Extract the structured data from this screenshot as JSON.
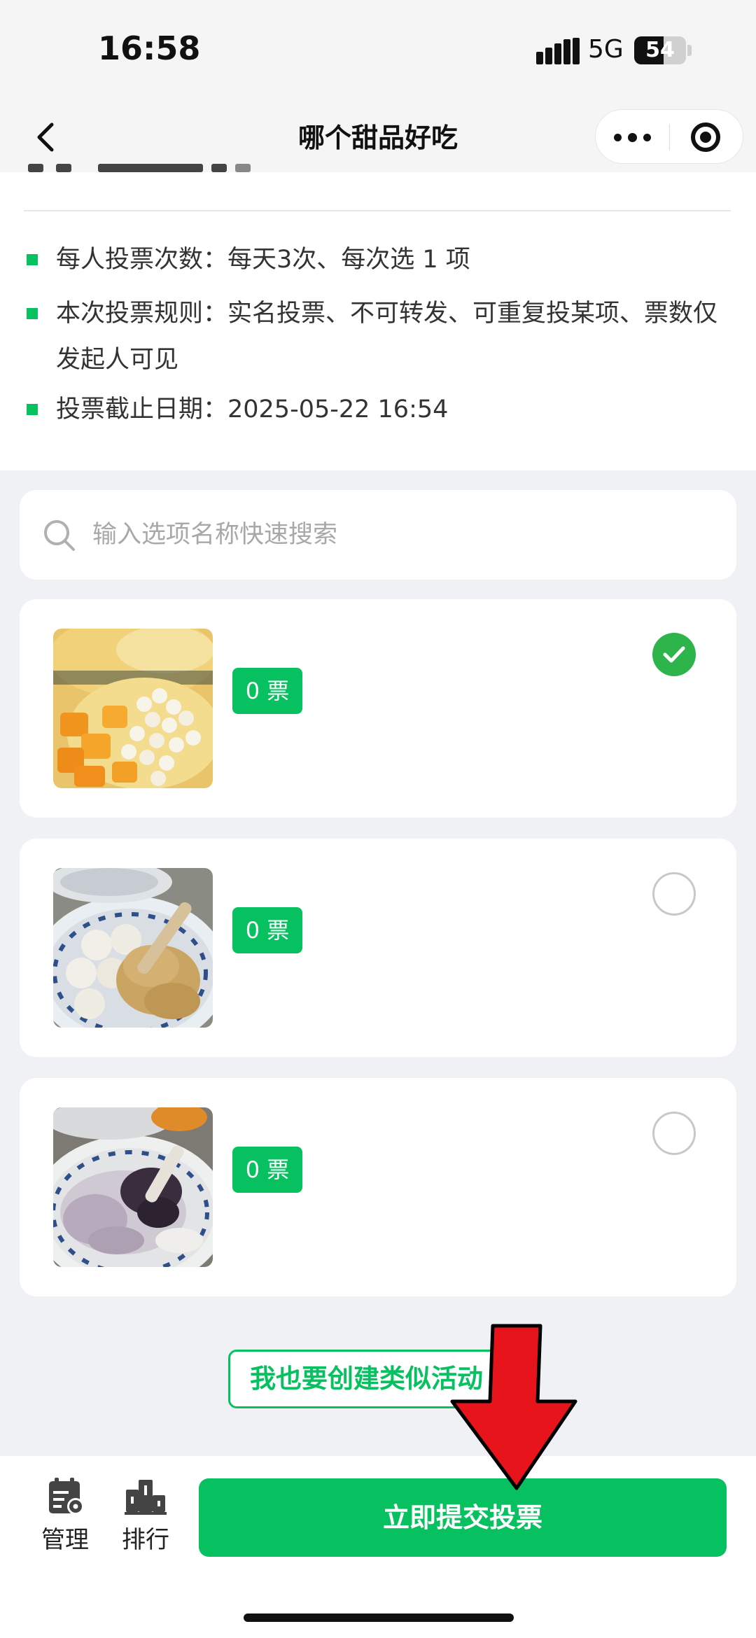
{
  "status_bar": {
    "time": "16:58",
    "network": "5G",
    "battery": "54"
  },
  "nav": {
    "title": "哪个甜品好吃"
  },
  "rules": [
    {
      "text": "每人投票次数：每天3次、每次选 1 项"
    },
    {
      "text": "本次投票规则：实名投票、不可转发、可重复投某项、票数仅发起人可见"
    },
    {
      "text": "投票截止日期：2025-05-22 16:54"
    }
  ],
  "search": {
    "placeholder": "输入选项名称快速搜索"
  },
  "options": [
    {
      "votes": "0 票",
      "selected": true
    },
    {
      "votes": "0 票",
      "selected": false
    },
    {
      "votes": "0 票",
      "selected": false
    }
  ],
  "create_similar": "我也要创建类似活动",
  "bottom": {
    "manage": "管理",
    "ranking": "排行",
    "submit": "立即提交投票"
  },
  "colors": {
    "accent": "#07c160",
    "check": "#2db44a",
    "annotation_arrow": "#e8141b"
  }
}
